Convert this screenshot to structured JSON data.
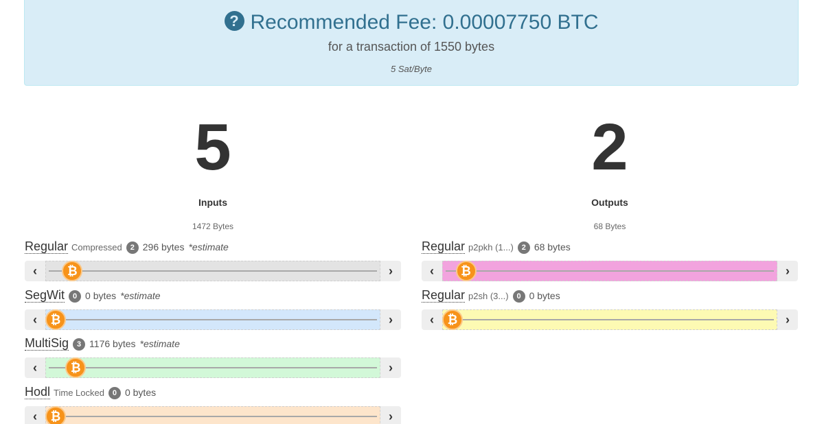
{
  "fee": {
    "title": "Recommended Fee: 0.00007750 BTC",
    "subtitle": "for a transaction of 1550 bytes",
    "rate": "5 Sat/Byte",
    "help_icon": "?"
  },
  "inputs": {
    "count": "5",
    "label": "Inputs",
    "bytes": "1472 Bytes",
    "rows": [
      {
        "name": "Regular",
        "sub": "Compressed",
        "badge": "2",
        "bytes": "296 bytes",
        "estimate": "*estimate",
        "track_color": "#e3e3e3",
        "level": 0.05
      },
      {
        "name": "SegWit",
        "sub": "",
        "badge": "0",
        "bytes": "0 bytes",
        "estimate": "*estimate",
        "track_color": "#d3e7fb",
        "level": 0.0
      },
      {
        "name": "MultiSig",
        "sub": "",
        "badge": "3",
        "bytes": "1176 bytes",
        "estimate": "*estimate",
        "track_color": "#d2f8d8",
        "level": 0.06
      },
      {
        "name": "Hodl",
        "sub": "Time Locked",
        "badge": "0",
        "bytes": "0 bytes",
        "estimate": "",
        "track_color": "#fde5cb",
        "level": 0.0
      }
    ]
  },
  "outputs": {
    "count": "2",
    "label": "Outputs",
    "bytes": "68 Bytes",
    "rows": [
      {
        "name": "Regular",
        "sub": "p2pkh (1...)",
        "badge": "2",
        "bytes": "68 bytes",
        "estimate": "",
        "track_color": "#f2a3de",
        "level": 0.04
      },
      {
        "name": "Regular",
        "sub": "p2sh (3...)",
        "badge": "0",
        "bytes": "0 bytes",
        "estimate": "",
        "track_color": "#fdfab3",
        "level": 0.0
      }
    ]
  },
  "icons": {
    "left": "‹",
    "right": "›",
    "bitcoin": "₿"
  }
}
